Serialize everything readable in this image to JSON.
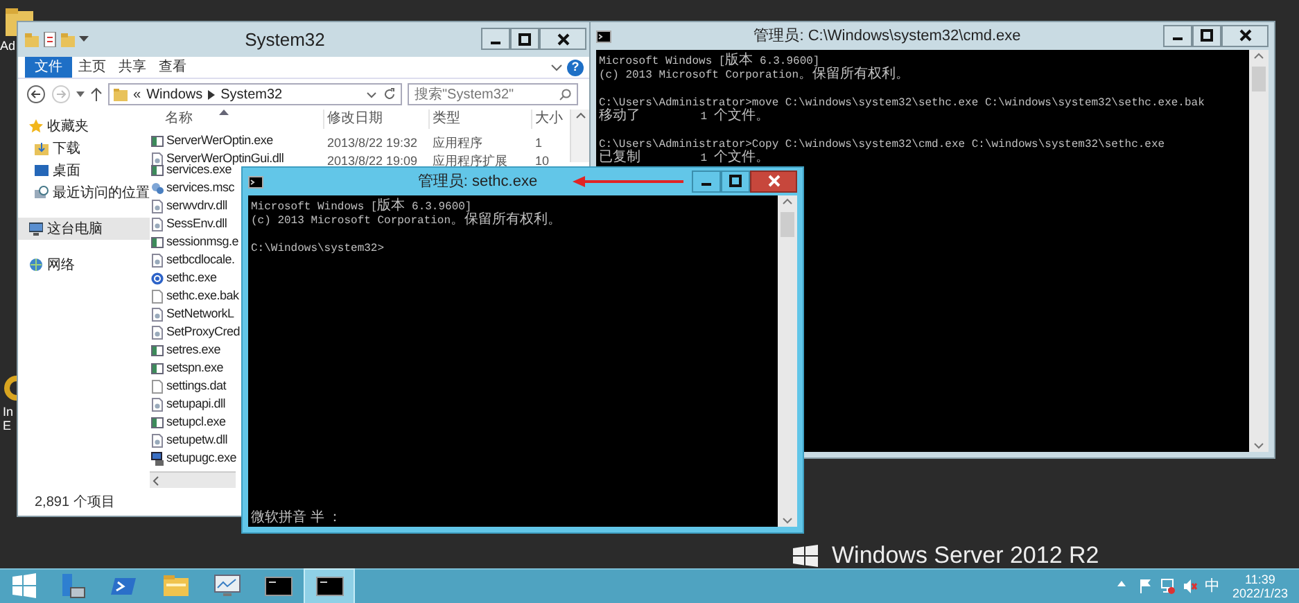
{
  "desktop_icons": [
    {
      "kind": "folder",
      "lines": [
        "Ad"
      ]
    },
    {
      "kind": "browser",
      "lines": [
        "In",
        "E"
      ]
    }
  ],
  "explorer": {
    "title": "System32",
    "ribbon": {
      "tabs": [
        {
          "label": "文件",
          "kind": "file"
        },
        {
          "label": "主页",
          "kind": "tab"
        },
        {
          "label": "共享",
          "kind": "tab"
        },
        {
          "label": "查看",
          "kind": "tab"
        }
      ],
      "help": "?"
    },
    "address": {
      "overflow": "«",
      "segments": [
        "Windows",
        "System32"
      ]
    },
    "search": {
      "placeholder": "搜索\"System32\""
    },
    "nav": [
      {
        "label": "收藏夹",
        "kind": "star",
        "selected": false,
        "children": [
          {
            "label": "下载",
            "kind": "download",
            "selected": false
          },
          {
            "label": "桌面",
            "kind": "desktop",
            "selected": false
          },
          {
            "label": "最近访问的位置",
            "kind": "recent",
            "selected": false
          }
        ]
      },
      {
        "label": "这台电脑",
        "kind": "computer",
        "selected": true
      },
      {
        "label": "网络",
        "kind": "network",
        "selected": false
      }
    ],
    "columns": [
      "名称",
      "修改日期",
      "类型",
      "大小"
    ],
    "rows": [
      {
        "name": "ServerWerOptin.exe",
        "kind": "exe",
        "date": "2013/8/22 19:32",
        "type": "应用程序",
        "size": "1"
      },
      {
        "name": "ServerWerOptinGui.dll",
        "kind": "dll",
        "date": "2013/8/22 19:09",
        "type": "应用程序扩展",
        "size": "10"
      },
      {
        "name": "services.exe",
        "kind": "exe"
      },
      {
        "name": "services.msc",
        "kind": "msc"
      },
      {
        "name": "serwvdrv.dll",
        "kind": "dll"
      },
      {
        "name": "SessEnv.dll",
        "kind": "dll"
      },
      {
        "name": "sessionmsg.e",
        "kind": "exe"
      },
      {
        "name": "setbcdlocale.",
        "kind": "dll"
      },
      {
        "name": "sethc.exe",
        "kind": "ease"
      },
      {
        "name": "sethc.exe.bak",
        "kind": "file"
      },
      {
        "name": "SetNetworkL",
        "kind": "dll"
      },
      {
        "name": "SetProxyCred",
        "kind": "dll"
      },
      {
        "name": "setres.exe",
        "kind": "exe"
      },
      {
        "name": "setspn.exe",
        "kind": "exe"
      },
      {
        "name": "settings.dat",
        "kind": "file"
      },
      {
        "name": "setupapi.dll",
        "kind": "dll"
      },
      {
        "name": "setupcl.exe",
        "kind": "exe"
      },
      {
        "name": "setupetw.dll",
        "kind": "dll"
      },
      {
        "name": "setupugc.exe",
        "kind": "setup"
      }
    ],
    "status": "2,891 个项目"
  },
  "console_back": {
    "title": "管理员: C:\\Windows\\system32\\cmd.exe",
    "active": false,
    "blocks": [
      [
        "Microsoft Windows [版本 6.3.9600]",
        "(c) 2013 Microsoft Corporation。保留所有权利。"
      ],
      [
        "C:\\Users\\Administrator>move C:\\windows\\system32\\sethc.exe C:\\windows\\system32\\sethc.exe.bak",
        "移动了         1 个文件。"
      ],
      [
        "C:\\Users\\Administrator>Copy C:\\windows\\system32\\cmd.exe C:\\windows\\system32\\sethc.exe",
        "已复制         1 个文件。"
      ]
    ]
  },
  "console_front": {
    "title": "管理员: sethc.exe",
    "active": true,
    "blocks": [
      [
        "Microsoft Windows [版本 6.3.9600]",
        "(c) 2013 Microsoft Corporation。保留所有权利。"
      ],
      [
        "C:\\Windows\\system32>"
      ]
    ],
    "ime": "微软拼音 半 ："
  },
  "branding": "Windows Server 2012 R2",
  "taskbar": {
    "apps": [
      {
        "kind": "start",
        "selected": false
      },
      {
        "kind": "server-manager",
        "selected": false
      },
      {
        "kind": "powershell",
        "selected": false
      },
      {
        "kind": "explorer",
        "selected": false
      },
      {
        "kind": "monitor",
        "selected": false
      },
      {
        "kind": "console",
        "selected": false
      },
      {
        "kind": "console",
        "selected": true
      }
    ],
    "tray": [
      {
        "kind": "up"
      },
      {
        "kind": "flag"
      },
      {
        "kind": "network"
      },
      {
        "kind": "speaker-muted"
      }
    ],
    "ime": "中",
    "time": "11:39",
    "date": "2022/1/23"
  }
}
